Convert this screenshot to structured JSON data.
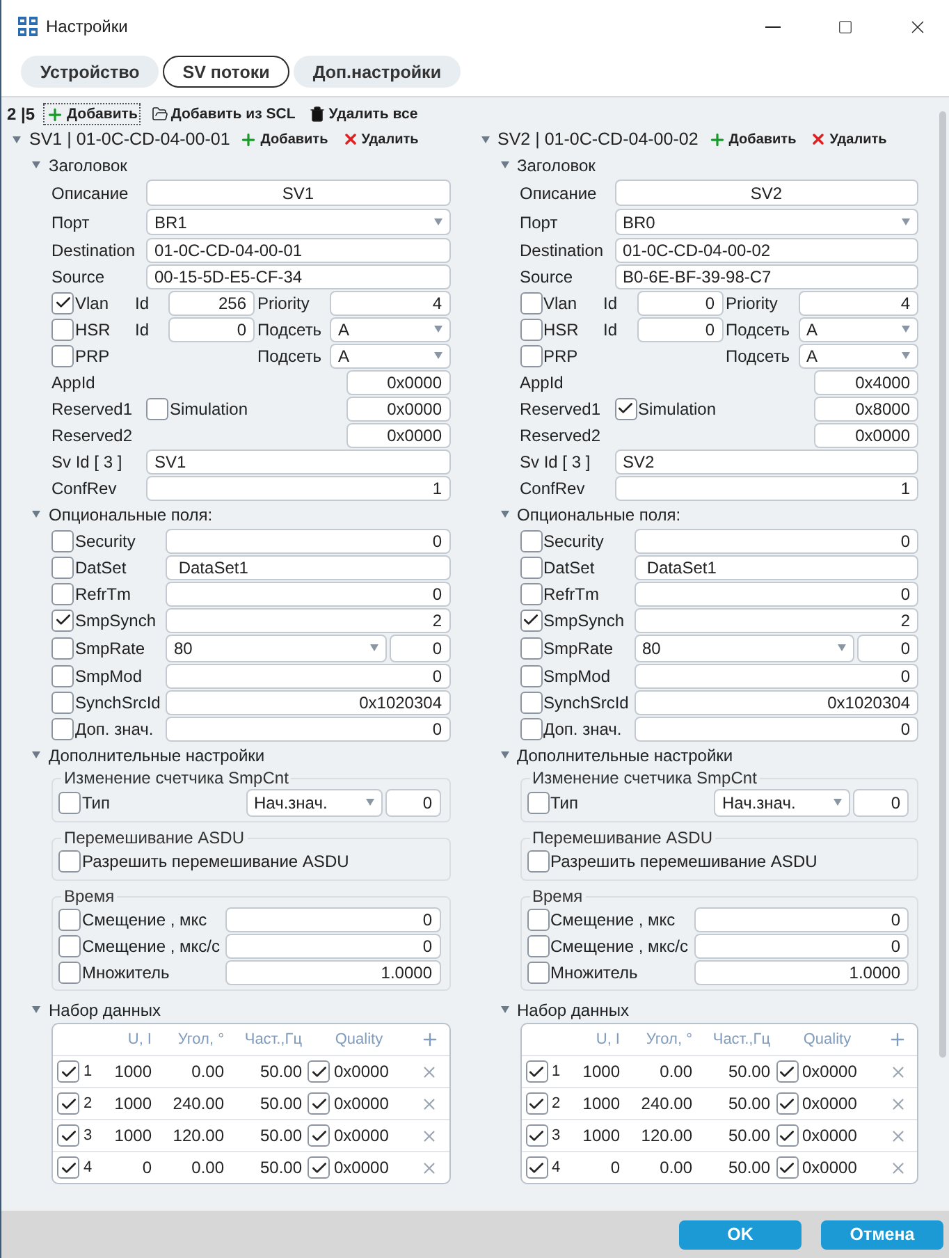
{
  "window": {
    "title": "Настройки"
  },
  "tabs": [
    {
      "label": "Устройство",
      "selected": false
    },
    {
      "label": "SV потоки",
      "selected": true
    },
    {
      "label": "Доп.настройки",
      "selected": false
    }
  ],
  "toolbar": {
    "counter": "2 |5",
    "add": "Добавить",
    "add_from_scl": "Добавить из SCL",
    "delete_all": "Удалить все"
  },
  "streams": [
    {
      "title": "SV1 | 01-0C-CD-04-00-01",
      "expanded": true,
      "add": "Добавить",
      "remove": "Удалить",
      "header": {
        "label": "Заголовок",
        "expanded": true,
        "description": {
          "label": "Описание",
          "value": "SV1"
        },
        "port": {
          "label": "Порт",
          "value": "BR1"
        },
        "destination": {
          "label": "Destination",
          "value": "01-0C-CD-04-00-01"
        },
        "source": {
          "label": "Source",
          "value": "00-15-5D-E5-CF-34"
        },
        "vlan": {
          "label": "Vlan",
          "checked": true,
          "id_label": "Id",
          "id": "256",
          "priority_label": "Priority",
          "priority": "4"
        },
        "hsr": {
          "label": "HSR",
          "checked": false,
          "id_label": "Id",
          "id": "0",
          "subnet_label": "Подсеть",
          "subnet": "A"
        },
        "prp": {
          "label": "PRP",
          "checked": false,
          "subnet_label": "Подсеть",
          "subnet": "A"
        },
        "appid": {
          "label": "AppId",
          "value": "0x0000"
        },
        "reserved1": {
          "label": "Reserved1",
          "simulation_label": "Simulation",
          "simulation": false,
          "value": "0x0000"
        },
        "reserved2": {
          "label": "Reserved2",
          "value": "0x0000"
        },
        "svid": {
          "label": "Sv Id [ 3 ]",
          "value": "SV1"
        },
        "confrev": {
          "label": "ConfRev",
          "value": "1"
        }
      },
      "optional": {
        "label": "Опциональные поля:",
        "expanded": true,
        "fields": [
          {
            "kind": "number",
            "label": "Security",
            "checked": false,
            "value": "0"
          },
          {
            "kind": "text",
            "label": "DatSet",
            "checked": false,
            "value": "DataSet1"
          },
          {
            "kind": "number",
            "label": "RefrTm",
            "checked": false,
            "value": "0"
          },
          {
            "kind": "number",
            "label": "SmpSynch",
            "checked": true,
            "value": "2"
          },
          {
            "kind": "rate",
            "label": "SmpRate",
            "checked": false,
            "value": "80",
            "extra": "0"
          },
          {
            "kind": "number",
            "label": "SmpMod",
            "checked": false,
            "value": "0"
          },
          {
            "kind": "number",
            "label": "SynchSrcId",
            "checked": false,
            "value": "0x1020304"
          },
          {
            "kind": "number",
            "label": "Доп. знач.",
            "checked": false,
            "value": "0"
          }
        ]
      },
      "advanced": {
        "label": "Дополнительные настройки",
        "expanded": true,
        "smpcnt": {
          "legend": "Изменение счетчика SmpCnt",
          "label": "Тип",
          "checked": false,
          "mode": "Нач.знач.",
          "value": "0"
        },
        "asdu": {
          "legend": "Перемешивание ASDU",
          "label": "Разрешить перемешивание ASDU",
          "checked": false
        },
        "time": {
          "legend": "Время",
          "fields": [
            {
              "label": "Смещение , мкс",
              "checked": false,
              "value": "0"
            },
            {
              "label": "Смещение , мкс/с",
              "checked": false,
              "value": "0"
            },
            {
              "label": "Множитель",
              "checked": false,
              "value": "1.0000"
            }
          ]
        }
      },
      "dataset": {
        "label": "Набор данных",
        "expanded": true,
        "columns": [
          "U, I",
          "Угол, °",
          "Част.,Гц",
          "Quality"
        ],
        "rows": [
          {
            "enabled": true,
            "index": "1",
            "u": "1000",
            "angle": "0.00",
            "freq": "50.00",
            "quality_checked": true,
            "quality": "0x0000"
          },
          {
            "enabled": true,
            "index": "2",
            "u": "1000",
            "angle": "240.00",
            "freq": "50.00",
            "quality_checked": true,
            "quality": "0x0000"
          },
          {
            "enabled": true,
            "index": "3",
            "u": "1000",
            "angle": "120.00",
            "freq": "50.00",
            "quality_checked": true,
            "quality": "0x0000"
          },
          {
            "enabled": true,
            "index": "4",
            "u": "0",
            "angle": "0.00",
            "freq": "50.00",
            "quality_checked": true,
            "quality": "0x0000"
          }
        ]
      }
    },
    {
      "title": "SV2 | 01-0C-CD-04-00-02",
      "expanded": true,
      "add": "Добавить",
      "remove": "Удалить",
      "header": {
        "label": "Заголовок",
        "expanded": true,
        "description": {
          "label": "Описание",
          "value": "SV2"
        },
        "port": {
          "label": "Порт",
          "value": "BR0"
        },
        "destination": {
          "label": "Destination",
          "value": "01-0C-CD-04-00-02"
        },
        "source": {
          "label": "Source",
          "value": "B0-6E-BF-39-98-C7"
        },
        "vlan": {
          "label": "Vlan",
          "checked": false,
          "id_label": "Id",
          "id": "0",
          "priority_label": "Priority",
          "priority": "4"
        },
        "hsr": {
          "label": "HSR",
          "checked": false,
          "id_label": "Id",
          "id": "0",
          "subnet_label": "Подсеть",
          "subnet": "A"
        },
        "prp": {
          "label": "PRP",
          "checked": false,
          "subnet_label": "Подсеть",
          "subnet": "A"
        },
        "appid": {
          "label": "AppId",
          "value": "0x4000"
        },
        "reserved1": {
          "label": "Reserved1",
          "simulation_label": "Simulation",
          "simulation": true,
          "value": "0x8000"
        },
        "reserved2": {
          "label": "Reserved2",
          "value": "0x0000"
        },
        "svid": {
          "label": "Sv Id [ 3 ]",
          "value": "SV2"
        },
        "confrev": {
          "label": "ConfRev",
          "value": "1"
        }
      },
      "optional": {
        "label": "Опциональные поля:",
        "expanded": true,
        "fields": [
          {
            "kind": "number",
            "label": "Security",
            "checked": false,
            "value": "0"
          },
          {
            "kind": "text",
            "label": "DatSet",
            "checked": false,
            "value": "DataSet1"
          },
          {
            "kind": "number",
            "label": "RefrTm",
            "checked": false,
            "value": "0"
          },
          {
            "kind": "number",
            "label": "SmpSynch",
            "checked": true,
            "value": "2"
          },
          {
            "kind": "rate",
            "label": "SmpRate",
            "checked": false,
            "value": "80",
            "extra": "0"
          },
          {
            "kind": "number",
            "label": "SmpMod",
            "checked": false,
            "value": "0"
          },
          {
            "kind": "number",
            "label": "SynchSrcId",
            "checked": false,
            "value": "0x1020304"
          },
          {
            "kind": "number",
            "label": "Доп. знач.",
            "checked": false,
            "value": "0"
          }
        ]
      },
      "advanced": {
        "label": "Дополнительные настройки",
        "expanded": true,
        "smpcnt": {
          "legend": "Изменение счетчика SmpCnt",
          "label": "Тип",
          "checked": false,
          "mode": "Нач.знач.",
          "value": "0"
        },
        "asdu": {
          "legend": "Перемешивание ASDU",
          "label": "Разрешить перемешивание ASDU",
          "checked": false
        },
        "time": {
          "legend": "Время",
          "fields": [
            {
              "label": "Смещение , мкс",
              "checked": false,
              "value": "0"
            },
            {
              "label": "Смещение , мкс/с",
              "checked": false,
              "value": "0"
            },
            {
              "label": "Множитель",
              "checked": false,
              "value": "1.0000"
            }
          ]
        }
      },
      "dataset": {
        "label": "Набор данных",
        "expanded": true,
        "columns": [
          "U, I",
          "Угол, °",
          "Част.,Гц",
          "Quality"
        ],
        "rows": [
          {
            "enabled": true,
            "index": "1",
            "u": "1000",
            "angle": "0.00",
            "freq": "50.00",
            "quality_checked": true,
            "quality": "0x0000"
          },
          {
            "enabled": true,
            "index": "2",
            "u": "1000",
            "angle": "240.00",
            "freq": "50.00",
            "quality_checked": true,
            "quality": "0x0000"
          },
          {
            "enabled": true,
            "index": "3",
            "u": "1000",
            "angle": "120.00",
            "freq": "50.00",
            "quality_checked": true,
            "quality": "0x0000"
          },
          {
            "enabled": true,
            "index": "4",
            "u": "0",
            "angle": "0.00",
            "freq": "50.00",
            "quality_checked": true,
            "quality": "0x0000"
          }
        ]
      }
    }
  ],
  "buttons": {
    "ok": "OK",
    "cancel": "Отмена"
  }
}
